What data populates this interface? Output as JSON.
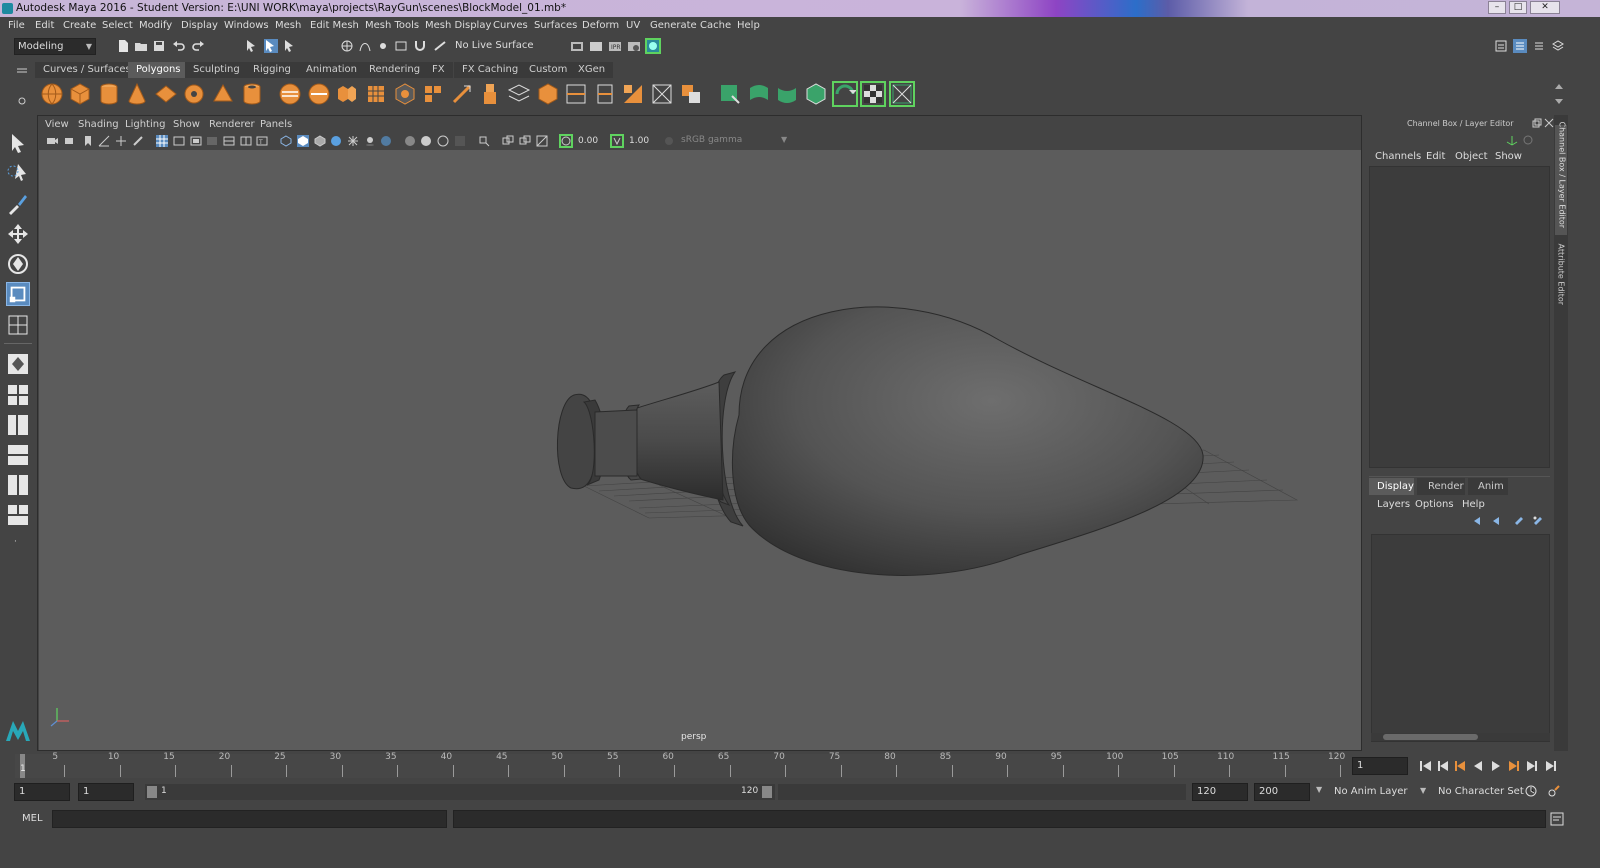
{
  "window": {
    "title": "Autodesk Maya 2016 - Student Version: E:\\UNI WORK\\maya\\projects\\RayGun\\scenes\\BlockModel_01.mb*"
  },
  "menubar": {
    "items": [
      "File",
      "Edit",
      "Create",
      "Select",
      "Modify",
      "Display",
      "Windows",
      "Mesh",
      "Edit Mesh",
      "Mesh Tools",
      "Mesh Display",
      "Curves",
      "Surfaces",
      "Deform",
      "UV",
      "Generate",
      "Cache",
      "Help"
    ]
  },
  "statusline": {
    "menuset": "Modeling",
    "live_surface": "No Live Surface"
  },
  "shelf": {
    "tabs": [
      "Curves / Surfaces",
      "Polygons",
      "Sculpting",
      "Rigging",
      "Animation",
      "Rendering",
      "FX",
      "FX Caching",
      "Custom",
      "XGen"
    ],
    "active_tab": "Polygons"
  },
  "viewport": {
    "panel_menus": [
      "View",
      "Shading",
      "Lighting",
      "Show",
      "Renderer",
      "Panels"
    ],
    "exposure": "0.00",
    "gamma": "1.00",
    "color_space": "sRGB gamma",
    "camera_label": "persp"
  },
  "channelbox": {
    "header": "Channel Box / Layer Editor",
    "menus": [
      "Channels",
      "Edit",
      "Object",
      "Show"
    ],
    "layer_tabs": [
      "Display",
      "Render",
      "Anim"
    ],
    "active_layer_tab": "Display",
    "layer_menus": [
      "Layers",
      "Options",
      "Help"
    ]
  },
  "side_tabs": {
    "tab1": "Channel Box / Layer Editor",
    "tab2": "Attribute Editor"
  },
  "timeline": {
    "ticks": [
      "5",
      "10",
      "15",
      "20",
      "25",
      "30",
      "35",
      "40",
      "45",
      "50",
      "55",
      "60",
      "65",
      "70",
      "75",
      "80",
      "85",
      "90",
      "95",
      "100",
      "105",
      "110",
      "115",
      "120"
    ],
    "first_tick": "1",
    "current_frame": "1"
  },
  "range": {
    "start_time": "1",
    "playback_start": "1",
    "slider_start": "1",
    "slider_end": "120",
    "playback_end": "120",
    "end_time": "200",
    "anim_layer": "No Anim Layer",
    "character_set": "No Character Set"
  },
  "cmdline": {
    "language": "MEL"
  },
  "colors": {
    "viewport_bg": "#5c5c5c",
    "ui_bg": "#444444",
    "shelf_orange": "#e8903c",
    "shelf_green": "#3aa36a",
    "highlight": "#5fd35f",
    "title_purple": "#c8b6d8"
  }
}
